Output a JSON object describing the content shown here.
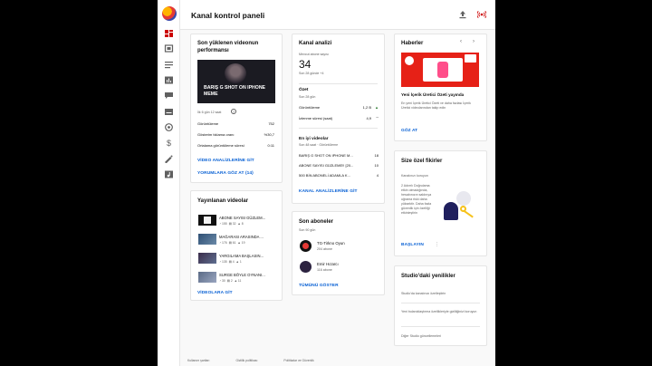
{
  "header": {
    "title": "Kanal kontrol paneli",
    "upload_icon": "upload-icon",
    "live_icon": "live-icon"
  },
  "rail": {
    "items": [
      "dashboard-icon",
      "content-icon",
      "playlist-icon",
      "analytics-icon",
      "comments-icon",
      "subtitles-icon",
      "copyright-icon",
      "earn-icon",
      "customize-icon",
      "audio-library-icon"
    ]
  },
  "latest": {
    "title": "Son yüklenen videonun performansı",
    "thumb_text": "BARIŞ G SHOT ON IPHONE MEME",
    "first_period": "İlk 6 gün 12 saat",
    "rows": [
      {
        "label": "Görüntüleme",
        "value": "752"
      },
      {
        "label": "Gösterim tıklama oranı",
        "value": "%30,7"
      },
      {
        "label": "Ortalama görüntüleme süresi",
        "value": "0:11"
      }
    ],
    "link1": "VİDEO ANALİZLERİNE GİT",
    "link2": "YORUMLARA GÖZ AT (14)"
  },
  "published": {
    "title": "Yayınlanan videolar",
    "items": [
      {
        "name": "ABONE SAYISI GÜZLEM...",
        "views": "155",
        "comments": "32",
        "likes": "8"
      },
      {
        "name": "MAĞARASI ARASINDA ...",
        "views": "176",
        "comments": "61",
        "likes": "19"
      },
      {
        "name": "YARGILAMA BAŞLASIN...",
        "views": "135",
        "comments": "4",
        "likes": "1"
      },
      {
        "name": "SURGE BÖYLE OYNANI...",
        "views": "30",
        "comments": "2",
        "likes": "11"
      }
    ],
    "link": "VİDEOLARA GİT"
  },
  "analytics": {
    "title": "Kanal analizi",
    "current_label": "Mevcut abone sayısı",
    "current_value": "34",
    "current_change": "Son 28 günde +4",
    "summary_title": "Özet",
    "summary_period": "Son 28 gün",
    "rows": [
      {
        "label": "Görüntüleme",
        "value": "1,2 B"
      },
      {
        "label": "İzlenme süresi (saat)",
        "value": "4,9"
      }
    ],
    "top_title": "En iyi videolar",
    "top_period": "Son 48 saat · Görüntüleme",
    "top": [
      {
        "name": "BARIŞ G SHOT ON IPHONE M...",
        "value": "18"
      },
      {
        "name": "ABONE SAYISI GÜZLEME!! [20...",
        "value": "10"
      },
      {
        "name": "500 BİN ABONELİ ADAMLA K...",
        "value": "4"
      }
    ],
    "link": "KANAL ANALİZLERİNE GİT"
  },
  "subs": {
    "title": "Son aboneler",
    "period": "Son 90 gün",
    "items": [
      {
        "name": "TG-Tirkno Oyun",
        "count": "204 abone"
      },
      {
        "name": "Emir Hızarcı",
        "count": "116 abone"
      }
    ],
    "link": "TÜMÜNÜ GÖSTER"
  },
  "news": {
    "title": "Haberler",
    "headline": "Yeni İçerik Üretici Özeti yayında",
    "body": "En yeni İçerik Üretici Özeti ve daha fazlası İçerik Üretici videolarından takip edin",
    "link": "GÖZ AT"
  },
  "ideas": {
    "title": "Size özel fikirler",
    "subtitle": "Kanalınızı koruyun",
    "body": "2 Adımlı Doğrulama etkin olmadığında, hesabınızın saldırıya uğrama riski daha yüksektir. Daha fazla güvenlik için özelliği etkinleştirin",
    "link": "BAŞLAYIN"
  },
  "studio": {
    "title": "Studio'daki yenilikler",
    "items": [
      "Studio'da kanalınızı özelleştirin",
      "Yeni bulanıklaştırma özellikleriyle gizliliğinizi koruyun",
      "Diğer Studio güncellemeleri"
    ]
  },
  "footer": {
    "links": [
      "Kullanım şartları",
      "Gizlilik politikası",
      "Politikalar ve Güvenlik"
    ]
  },
  "colors": {
    "accent": "#065fd4",
    "active": "#cc0000",
    "news_bg": "#e62117"
  }
}
